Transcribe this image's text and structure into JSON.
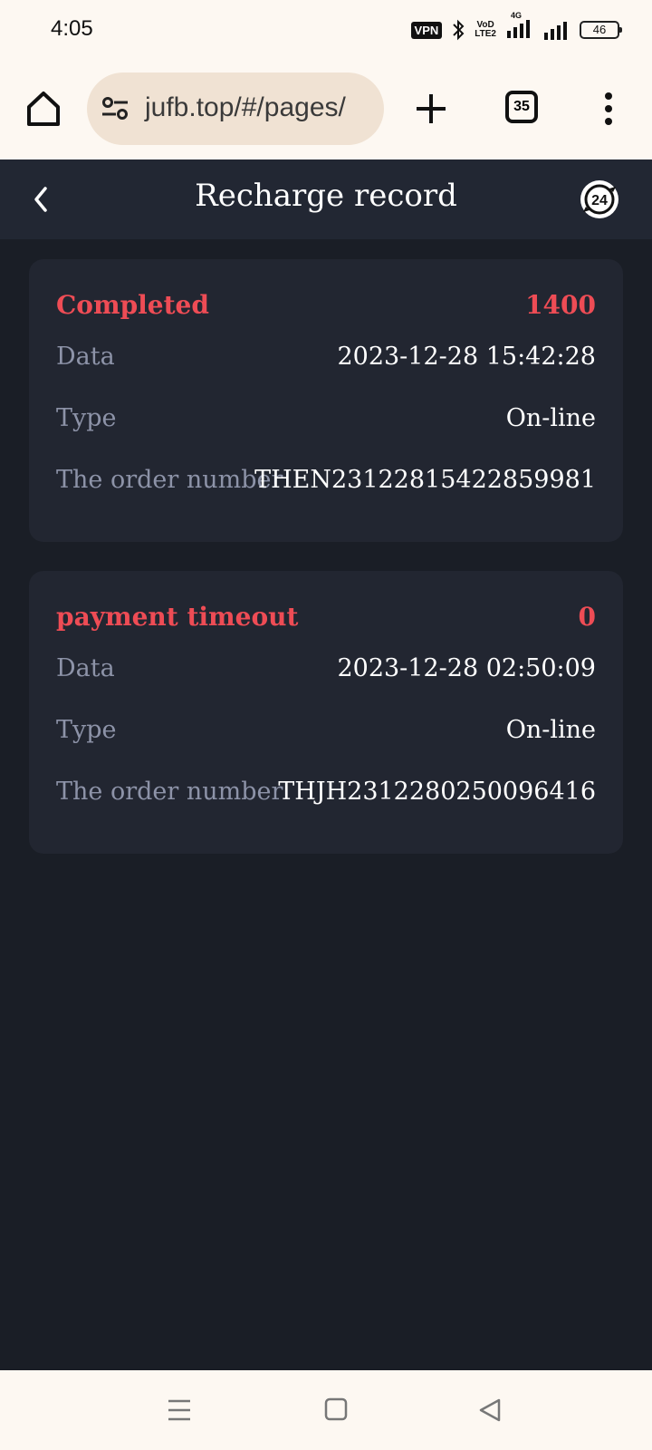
{
  "status_bar": {
    "time": "4:05",
    "vpn": "VPN",
    "net_top": "VoD",
    "net_bottom": "LTE2",
    "net_gen": "4G",
    "battery": "46"
  },
  "browser": {
    "url": "jufb.top/#/pages/",
    "tab_count": "35"
  },
  "header": {
    "title": "Recharge record"
  },
  "records": [
    {
      "status": "Completed",
      "amount": "1400",
      "date_label": "Data",
      "date_value": "2023-12-28 15:42:28",
      "type_label": "Type",
      "type_value": "On-line",
      "order_label": "The order number",
      "order_value": "THEN23122815422859981"
    },
    {
      "status": "payment timeout",
      "amount": "0",
      "date_label": "Data",
      "date_value": "2023-12-28 02:50:09",
      "type_label": "Type",
      "type_value": "On-line",
      "order_label": "The order number",
      "order_value": "THJH2312280250096416"
    }
  ],
  "colors": {
    "accent_red": "#ee4c55",
    "app_background": "#1a1e26",
    "card_background": "#222631",
    "browser_chrome": "#fdf8f2"
  },
  "icons": {
    "home": "home-icon",
    "site_settings": "tune-icon",
    "new_tab": "plus-icon",
    "menu": "more-vert-icon",
    "back": "chevron-left-icon",
    "support": "support-24h-icon"
  }
}
